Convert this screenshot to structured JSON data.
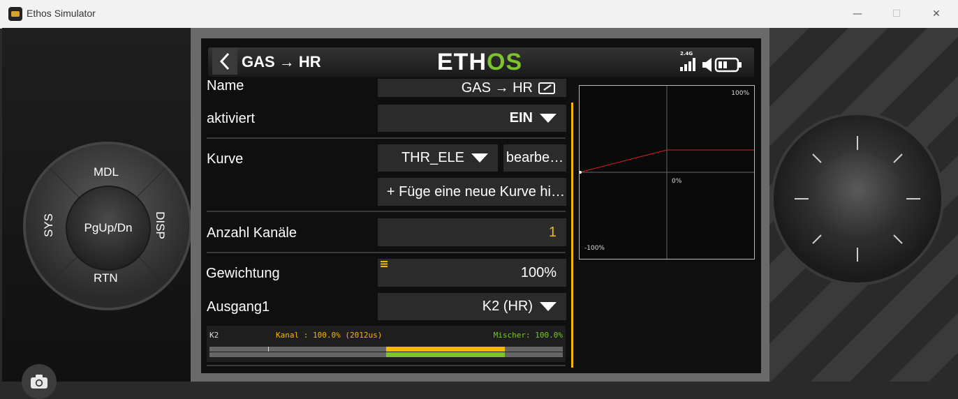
{
  "window": {
    "title": "Ethos Simulator"
  },
  "controls": {
    "mdl": "MDL",
    "rtn": "RTN",
    "sys": "SYS",
    "disp": "DISP",
    "center": "PgUp/Dn"
  },
  "header": {
    "title": "GAS → HR",
    "logo_part1": "ETH",
    "logo_part2": "OS",
    "signal": "2.4G"
  },
  "form": {
    "name_label": "Name",
    "name_value": "GAS → HR",
    "activated_label": "aktiviert",
    "activated_value": "EIN",
    "curve_label": "Kurve",
    "curve_value": "THR_ELE",
    "curve_edit": "bearbe…",
    "curve_add": "+ Füge eine neue Kurve hi…",
    "channels_label": "Anzahl Kanäle",
    "channels_value": "1",
    "weight_label": "Gewichtung",
    "weight_value": "100%",
    "output_label": "Ausgang1",
    "output_value": "K2 (HR)"
  },
  "channel_monitor": {
    "channel": "K2",
    "kanal_text": "Kanal  : 100.0% (2012us)",
    "mixer_text": "Mischer: 100.0%",
    "kanal_fraction": 0.5,
    "mixer_fraction": 0.5
  },
  "curve_graph": {
    "top_label": "100%",
    "mid_label": "0%",
    "bottom_label": "-100%"
  },
  "colors": {
    "accent_yellow": "#f5b800",
    "accent_green": "#7cc42a",
    "curve_line": "#e02020"
  }
}
